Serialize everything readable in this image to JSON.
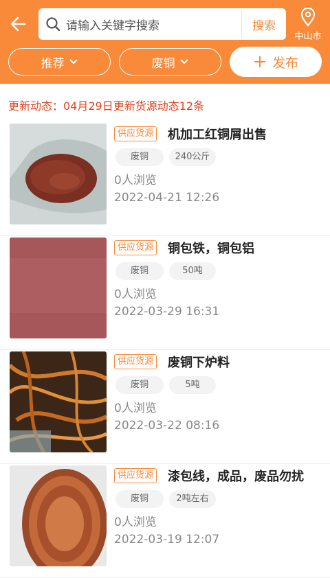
{
  "header": {
    "search_placeholder": "请输入关键字搜索",
    "search_button": "搜索",
    "city": "中山市"
  },
  "filters": {
    "sort": "推荐",
    "category": "废铜",
    "publish": "发布"
  },
  "update_notice": "更新动态：04月29日更新货源动态12条",
  "listings": [
    {
      "tag": "供应货源",
      "title": "机加工红铜屑出售",
      "category": "废铜",
      "quantity": "240公斤",
      "views": "0人浏览",
      "time": "2022-04-21 12:26"
    },
    {
      "tag": "供应货源",
      "title": "铜包铁，铜包铝",
      "category": "废铜",
      "quantity": "50吨",
      "views": "0人浏览",
      "time": "2022-03-29 16:31"
    },
    {
      "tag": "供应货源",
      "title": "废铜下炉料",
      "category": "废铜",
      "quantity": "5吨",
      "views": "0人浏览",
      "time": "2022-03-22 08:16"
    },
    {
      "tag": "供应货源",
      "title": "漆包线，成品，废品勿扰",
      "category": "废铜",
      "quantity": "2吨左右",
      "views": "0人浏览",
      "time": "2022-03-19 12:07"
    }
  ],
  "colors": {
    "accent": "#f98a3a",
    "notice": "#e04323"
  }
}
